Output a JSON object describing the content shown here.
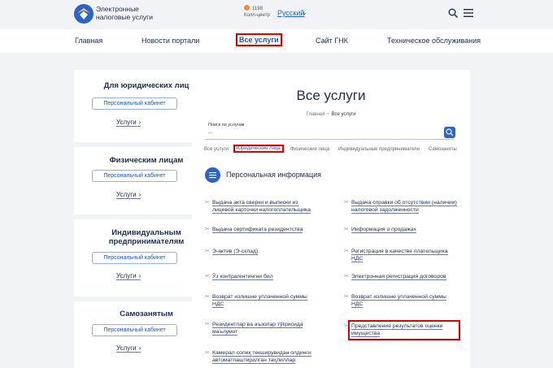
{
  "header": {
    "brand_line1": "Электронные",
    "brand_line2": "налоговые услуги",
    "call_number": "1198",
    "call_label": "Колл-центр",
    "language": "Русский"
  },
  "nav": {
    "items": [
      "Главная",
      "Новости портали",
      "Все услуги",
      "Сайт ГНК",
      "Техническое обслуживания"
    ],
    "active": "Все услуги"
  },
  "sidebar": [
    {
      "title": "Для юридических лиц",
      "button": "Персональный кабинет",
      "link": "Услуги"
    },
    {
      "title": "Физическим лицам",
      "button": "Персональный кабинет",
      "link": "Услуги"
    },
    {
      "title_line1": "Индивидуальным",
      "title_line2": "предпринимателям",
      "button": "Персональный кабинет",
      "link": "Услуги"
    },
    {
      "title": "Самозанятым",
      "button": "Персональный кабинет",
      "link": "Услуги"
    }
  ],
  "main": {
    "title": "Все услуги",
    "breadcrumb": [
      "Главная",
      "Все услуги"
    ],
    "search_label": "Поиск по услугам",
    "search_value": "...",
    "tabs": [
      "Все услуги",
      "Юридические лица",
      "Физические лица",
      "Индивидуальные предприниматели",
      "Самозаняты"
    ],
    "active_tab": "Юридические лица",
    "section_title": "Персональная информация",
    "services_left": [
      [
        "Выдача акта сверки и выписки из",
        "лицевой карточки налогоплательщика"
      ],
      [
        "Выдача сертификата резидентства"
      ],
      [
        "Э-актив (Э-склад)"
      ],
      [
        "Ўз контрагентингни бил"
      ],
      [
        "Возврат излишне уплаченной суммы",
        "НДС"
      ],
      [
        "Резидентлар ва аъзолар тўғрисида",
        "маълумот"
      ],
      [
        "Камерал солиқ текширувидан олдинги",
        "автоматлаштирилган таҳлиллар"
      ]
    ],
    "services_right": [
      [
        "Выдача справки об отсутствии (наличии)",
        "налоговой задолженности"
      ],
      [
        "Информация о продажах"
      ],
      [
        "Регистрация в качестве плательщика",
        "НДС"
      ],
      [
        "Электронная регистрация договоров"
      ],
      [
        "Возврат излишне уплаченной суммы",
        "НДС"
      ],
      [
        "Представление результатов оценки",
        "имущества"
      ]
    ]
  },
  "colors": {
    "accent": "#1f54c7",
    "highlight": "#e00000",
    "background": "#f1f3f7"
  }
}
